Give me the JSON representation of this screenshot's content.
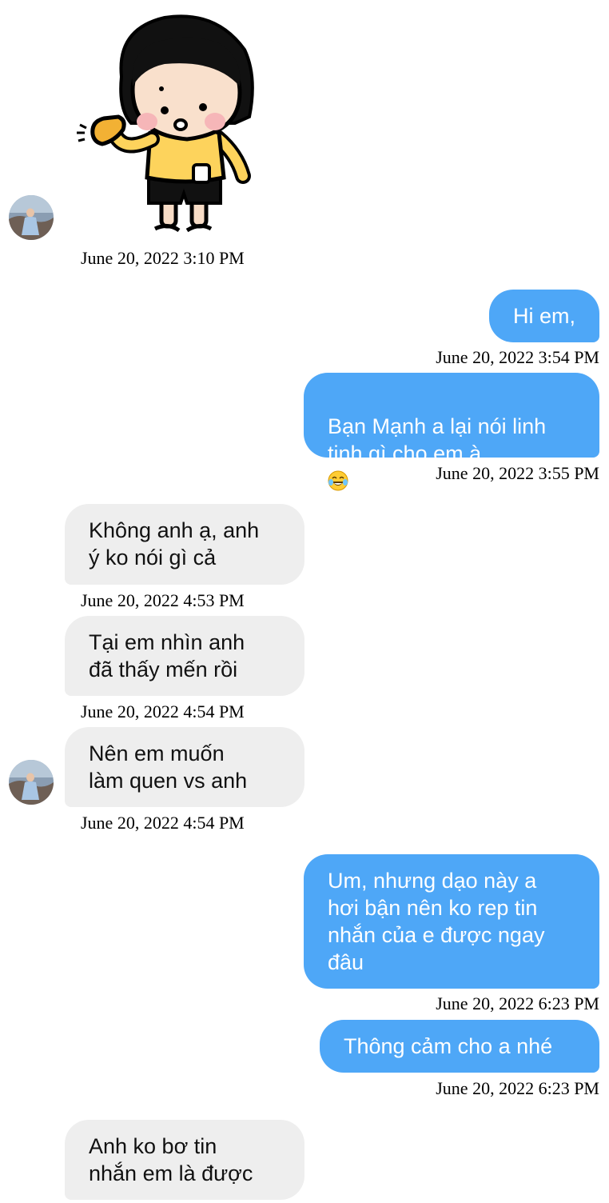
{
  "colors": {
    "outgoing_bubble": "#4ea7f7",
    "incoming_bubble": "#eeeeee",
    "sticker_shirt": "#fdd35c",
    "sticker_cheeks": "#f6b6b8"
  },
  "messages": [
    {
      "sender": "them",
      "type": "sticker",
      "sticker_icon": "girl-waving-sticker-icon",
      "timestamp": "June 20, 2022 3:10 PM"
    },
    {
      "sender": "me",
      "type": "text",
      "text": "Hi em,",
      "timestamp": "June 20, 2022 3:54 PM"
    },
    {
      "sender": "me",
      "type": "text",
      "text": "Bạn Mạnh a lại nói linh\ntinh gì cho em à",
      "emoji": "tears-of-joy-emoji-icon",
      "timestamp": "June 20, 2022 3:55 PM"
    },
    {
      "sender": "them",
      "type": "text",
      "text": "Không anh ạ, anh\ný ko nói gì cả",
      "timestamp": "June 20, 2022 4:53 PM"
    },
    {
      "sender": "them",
      "type": "text",
      "text": "Tại em nhìn anh\nđã thấy mến rồi",
      "timestamp": "June 20, 2022 4:54 PM"
    },
    {
      "sender": "them",
      "type": "text",
      "text": "Nên em muốn\nlàm quen vs anh",
      "timestamp": "June 20, 2022 4:54 PM"
    },
    {
      "sender": "me",
      "type": "text",
      "text": "Um, nhưng dạo này a\nhơi bận nên ko rep tin\nnhắn của e được ngay\nđâu",
      "timestamp": "June 20, 2022 6:23 PM"
    },
    {
      "sender": "me",
      "type": "text",
      "text": "Thông cảm cho a nhé",
      "timestamp": "June 20, 2022 6:23 PM"
    },
    {
      "sender": "them",
      "type": "text",
      "text": "Anh ko bơ tin\nnhắn em là được"
    }
  ]
}
